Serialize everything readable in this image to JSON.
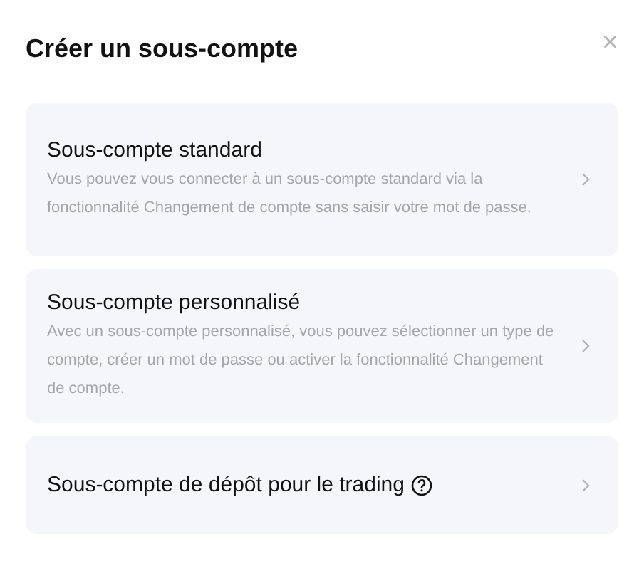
{
  "dialog": {
    "title": "Créer un sous-compte",
    "close": "×"
  },
  "options": [
    {
      "title": "Sous-compte standard",
      "description": "Vous pouvez vous connecter à un sous-compte standard via la fonctionnalité Changement de compte sans saisir votre mot de passe.",
      "help": false
    },
    {
      "title": "Sous-compte personnalisé",
      "description": "Avec un sous-compte personnalisé, vous pouvez sélectionner un type de compte, créer un mot de passe ou activer la fonctionnalité Changement de compte.",
      "help": false
    },
    {
      "title": "Sous-compte de dépôt pour le trading",
      "help": true
    }
  ]
}
